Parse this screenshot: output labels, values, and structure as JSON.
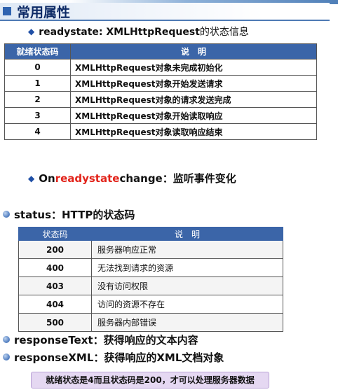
{
  "title": "常用属性",
  "readystate_heading": {
    "label": "readystate: XMLHttpRequest",
    "suffix": "的状态信息"
  },
  "readystate_table": {
    "headers": [
      "就绪状态码",
      "说　明"
    ],
    "rows": [
      {
        "code": "0",
        "desc": "XMLHttpRequest对象未完成初始化"
      },
      {
        "code": "1",
        "desc": "XMLHttpRequest对象开始发送请求"
      },
      {
        "code": "2",
        "desc": "XMLHttpRequest对象的请求发送完成"
      },
      {
        "code": "3",
        "desc": "XMLHttpRequest对象开始读取响应"
      },
      {
        "code": "4",
        "desc": "XMLHttpRequest对象读取响应结束"
      }
    ]
  },
  "onreadystatechange": {
    "prefix": "On",
    "highlight": "readystate",
    "suffix": "change：监听事件变化"
  },
  "status_heading": "status：HTTP的状态码",
  "status_table": {
    "headers": [
      "状态码",
      "说　明"
    ],
    "rows": [
      {
        "code": "200",
        "desc": "服务器响应正常"
      },
      {
        "code": "400",
        "desc": "无法找到请求的资源"
      },
      {
        "code": "403",
        "desc": "没有访问权限"
      },
      {
        "code": "404",
        "desc": "访问的资源不存在"
      },
      {
        "code": "500",
        "desc": "服务器内部错误"
      }
    ]
  },
  "response_text": "responseText：获得响应的文本内容",
  "response_xml": "responseXML：获得响应的XML文档对象",
  "note": "就绪状态是4而且状态码是200，才可以处理服务器数据",
  "colors": {
    "header_blue": "#3b65a8",
    "title_navy": "#0d2a66",
    "highlight_red": "#e2231a",
    "note_bg": "#e5d8f2"
  }
}
